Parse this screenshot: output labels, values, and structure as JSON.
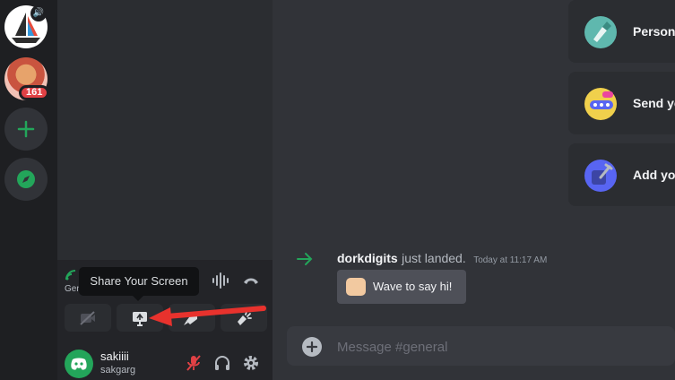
{
  "servers": {
    "unread_count": "161"
  },
  "voice": {
    "status": "",
    "channel": "Gen",
    "tooltip": "Share Your Screen"
  },
  "user": {
    "display_name": "sakiiii",
    "username": "sakgarg"
  },
  "cards": [
    {
      "label": "Persona",
      "icon": "paintbrush-icon",
      "color": "#5fb8ae"
    },
    {
      "label": "Send yo",
      "icon": "invite-chat-icon",
      "color": "#f0d04c"
    },
    {
      "label": "Add you",
      "icon": "app-wrench-icon",
      "color": "#5865f2"
    }
  ],
  "message": {
    "user": "dorkdigits",
    "text": "just landed.",
    "time": "Today at 11:17 AM",
    "wave_label": "Wave to say hi!"
  },
  "composer": {
    "placeholder": "Message #general"
  },
  "colors": {
    "accent_green": "#23a55a",
    "danger_red": "#e14145",
    "annotation_red": "#e8322d",
    "blurple": "#5865f2"
  }
}
